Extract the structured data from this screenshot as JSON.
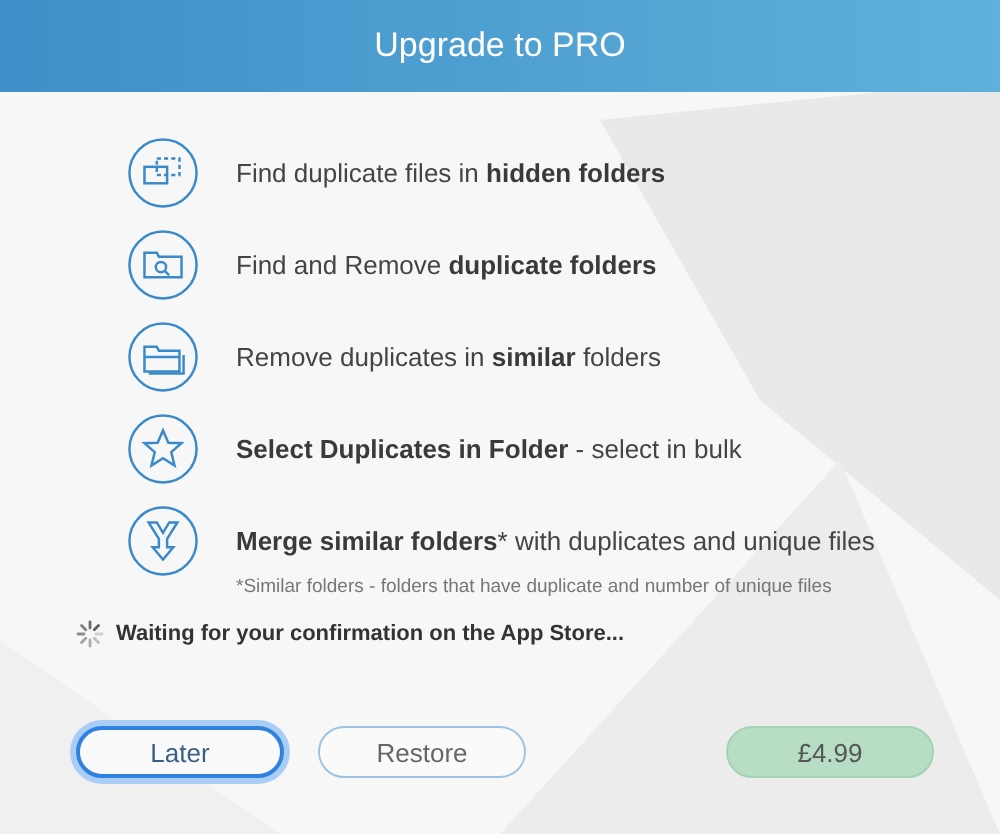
{
  "window": {
    "title": "Upgrade to PRO"
  },
  "features": [
    {
      "kind": "hidden",
      "text": "Find duplicate files in **hidden folders**"
    },
    {
      "kind": "search",
      "text": "Find and Remove **duplicate folders**"
    },
    {
      "kind": "folders",
      "text": "Remove duplicates in **similar** folders"
    },
    {
      "kind": "star",
      "text": "**Select Duplicates in Folder** - select in bulk"
    },
    {
      "kind": "merge",
      "text": "**Merge similar folders*** with duplicates and unique files",
      "note": "*Similar folders - folders that have duplicate and number of unique files"
    }
  ],
  "status": {
    "text": "Waiting for your confirmation on the App Store..."
  },
  "buttons": [
    {
      "kind": "later",
      "label": "Later",
      "focused": true
    },
    {
      "kind": "restore",
      "label": "Restore",
      "focused": false
    },
    {
      "kind": "price",
      "label": "£4.99",
      "focused": false
    }
  ]
}
